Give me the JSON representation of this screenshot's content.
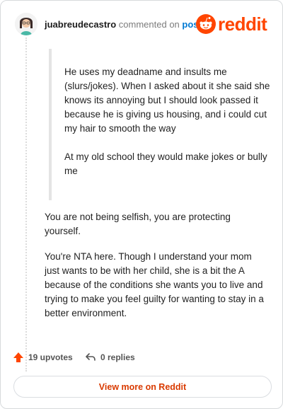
{
  "header": {
    "username": "juabreudecastro",
    "action": "commented on",
    "post_link": "post",
    "brand": "reddit",
    "brand_color": "#ff4500"
  },
  "quote": {
    "paragraphs": [
      "He uses my deadname and insults me (slurs/jokes). When I asked about it she said she knows its annoying but I should look passed it because he is giving us housing, and i could cut my hair to smooth the way",
      "At my old school they would make jokes or bully me"
    ]
  },
  "body": {
    "paragraphs": [
      "You are not being selfish, you are protecting yourself.",
      "You're NTA here. Though I understand your mom just wants to be with her child, she is a bit the A because of the conditions she wants you to live and trying to make you feel guilty for wanting to stay in a better environment."
    ]
  },
  "footer": {
    "upvotes": "19 upvotes",
    "replies": "0 replies",
    "view_more": "View more on Reddit",
    "upvote_icon": "upvote-arrow-icon",
    "reply_icon": "reply-arrow-icon"
  }
}
